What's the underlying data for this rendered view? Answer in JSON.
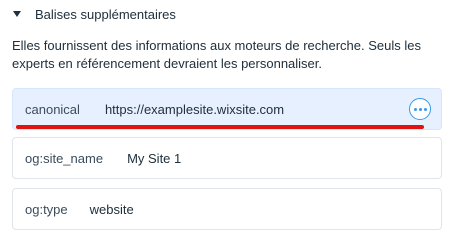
{
  "section": {
    "title": "Balises supplémentaires",
    "expanded": true
  },
  "description": "Elles fournissent des informations aux moteurs de recherche. Seuls les experts en référencement devraient les personnaliser.",
  "tags": [
    {
      "name": "canonical",
      "value": "https://examplesite.wixsite.com",
      "selected": true
    },
    {
      "name": "og:site_name",
      "value": "My Site 1",
      "selected": false
    },
    {
      "name": "og:type",
      "value": "website",
      "selected": false
    }
  ],
  "icons": {
    "caret": "caret-down-icon",
    "more": "more-horizontal-icon"
  },
  "colors": {
    "accent": "#3899ec",
    "selected_bg": "#e7f0ff",
    "annotation": "#e01313",
    "text": "#20303c"
  }
}
